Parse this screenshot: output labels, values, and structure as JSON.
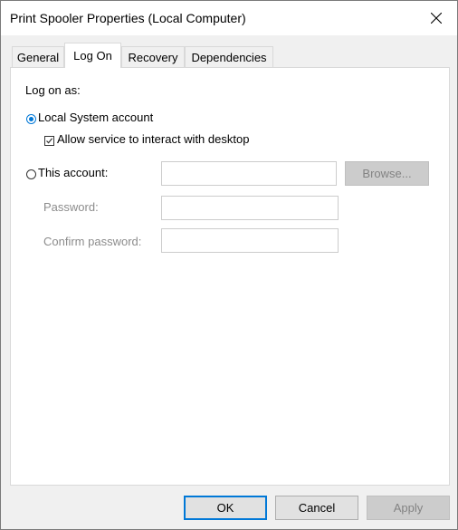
{
  "window": {
    "title": "Print Spooler Properties (Local Computer)"
  },
  "tabs": [
    {
      "label": "General"
    },
    {
      "label": "Log On"
    },
    {
      "label": "Recovery"
    },
    {
      "label": "Dependencies"
    }
  ],
  "logon": {
    "heading": "Log on as:",
    "local_system_label": "Local System account",
    "interact_label": "Allow service to interact with desktop",
    "this_account_label": "This account:",
    "account_value": "",
    "browse_label": "Browse...",
    "password_label": "Password:",
    "password_value": "",
    "confirm_label": "Confirm password:",
    "confirm_value": ""
  },
  "footer": {
    "ok_label": "OK",
    "cancel_label": "Cancel",
    "apply_label": "Apply"
  },
  "colors": {
    "accent": "#0078d7"
  }
}
